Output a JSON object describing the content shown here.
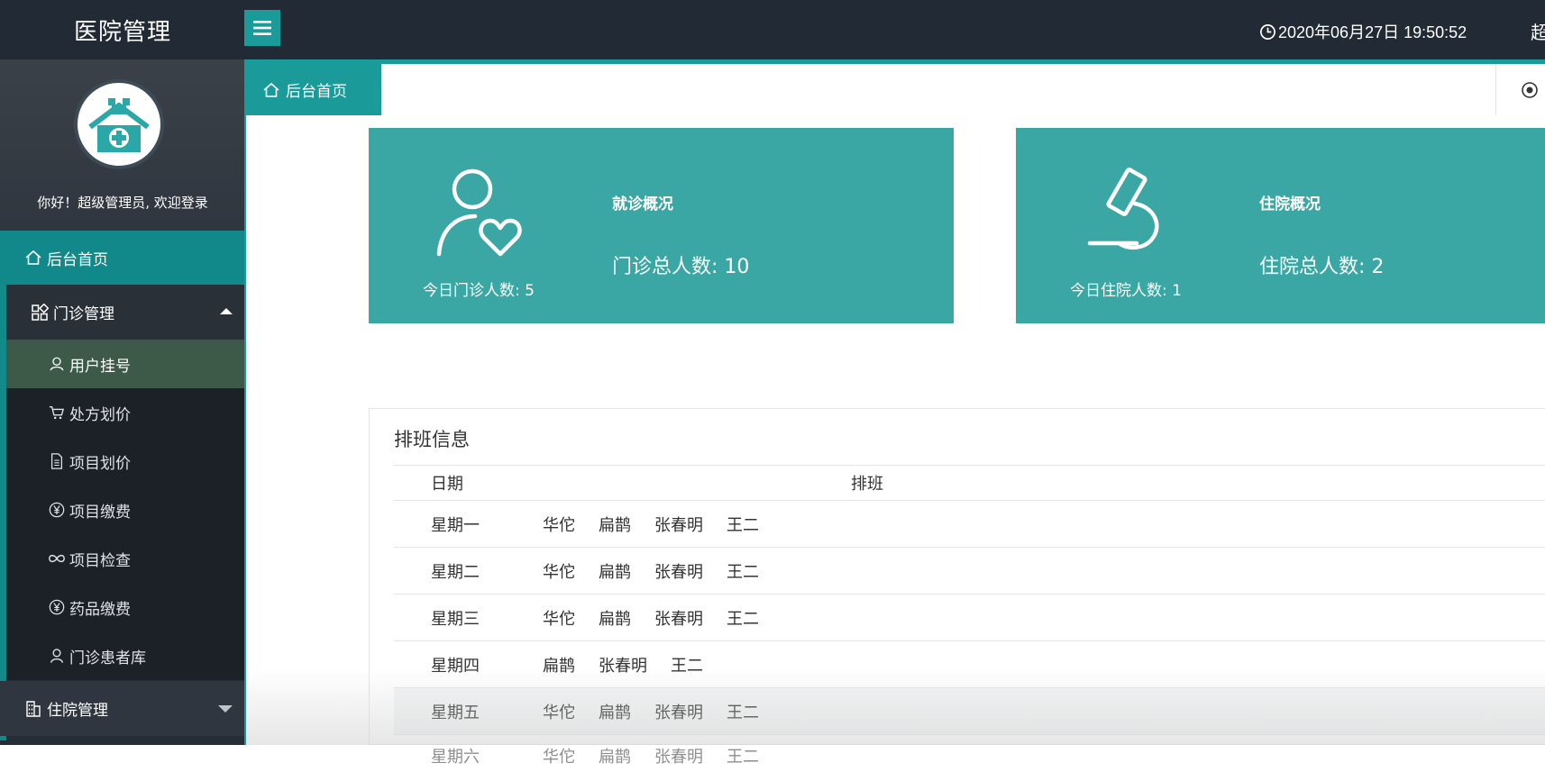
{
  "app": {
    "title": "医院管理"
  },
  "header": {
    "datetime": "2020年06月27日 19:50:52",
    "user_snippet": "超"
  },
  "sidebar": {
    "welcome": "你好！超级管理员, 欢迎登录",
    "home_label": "后台首页",
    "outpatient": {
      "label": "门诊管理",
      "items": [
        {
          "label": "用户挂号",
          "icon": "user-icon",
          "active": true
        },
        {
          "label": "处方划价",
          "icon": "cart-icon"
        },
        {
          "label": "项目划价",
          "icon": "document-icon"
        },
        {
          "label": "项目缴费",
          "icon": "yen-icon"
        },
        {
          "label": "项目检查",
          "icon": "infinity-icon"
        },
        {
          "label": "药品缴费",
          "icon": "yen-icon"
        },
        {
          "label": "门诊患者库",
          "icon": "person-icon"
        }
      ]
    },
    "inpatient": {
      "label": "住院管理"
    }
  },
  "tabs": {
    "home": "后台首页"
  },
  "cards": {
    "outpatient": {
      "title": "就诊概况",
      "today": "今日门诊人数: 5",
      "total": "门诊总人数: 10"
    },
    "inpatient": {
      "title": "住院概况",
      "today": "今日住院人数: 1",
      "total": "住院总人数: 2"
    }
  },
  "schedule": {
    "title": "排班信息",
    "headers": {
      "date": "日期",
      "schedule": "排班"
    },
    "rows": [
      {
        "day": "星期一",
        "doctors": [
          "华佗",
          "扁鹊",
          "张春明",
          "王二"
        ]
      },
      {
        "day": "星期二",
        "doctors": [
          "华佗",
          "扁鹊",
          "张春明",
          "王二"
        ]
      },
      {
        "day": "星期三",
        "doctors": [
          "华佗",
          "扁鹊",
          "张春明",
          "王二"
        ]
      },
      {
        "day": "星期四",
        "doctors": [
          "扁鹊",
          "张春明",
          "王二"
        ]
      },
      {
        "day": "星期五",
        "doctors": [
          "华佗",
          "扁鹊",
          "张春明",
          "王二"
        ]
      },
      {
        "day": "星期六",
        "doctors": [
          "华佗",
          "扁鹊",
          "张春明",
          "王二"
        ]
      }
    ]
  },
  "colors": {
    "teal": "#1b9a9a",
    "card": "#3aa7a5",
    "topbar": "#222a35",
    "sidebar": "#272d36"
  }
}
